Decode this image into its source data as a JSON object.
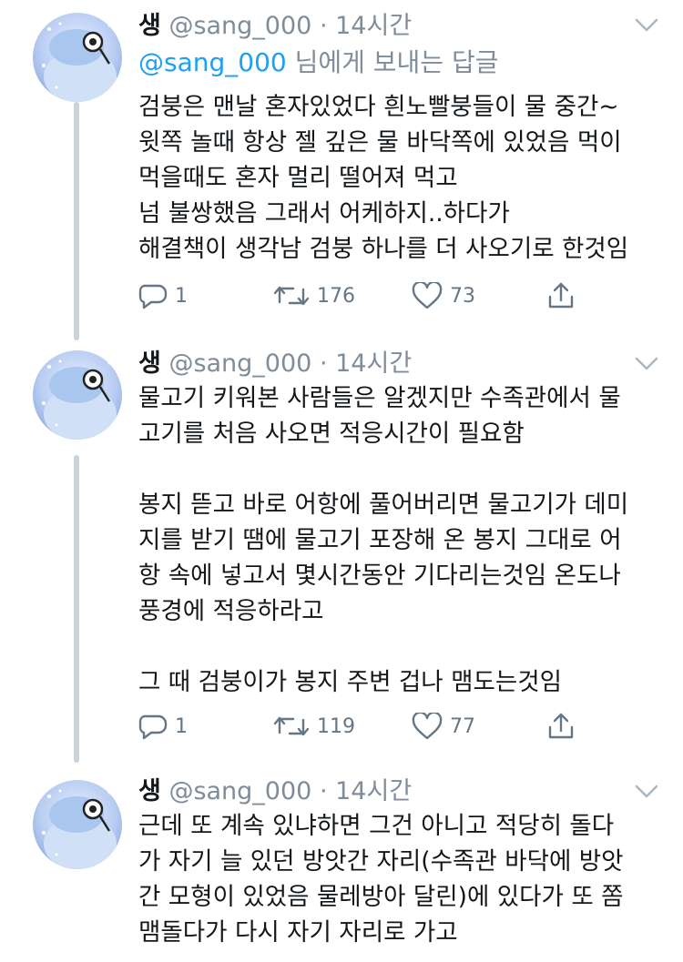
{
  "tweets": [
    {
      "display_name": "생",
      "handle": "@sang_000",
      "dot": "·",
      "time": "14시간",
      "replying_mention": "@sang_000",
      "replying_suffix": " 님에게 보내는 답글",
      "text": "검붕은 맨날 혼자있었다 흰노빨붕들이 물 중간~\n윗쪽 놀때 항상 젤 깊은 물 바닥쪽에 있었음 먹이\n먹을때도 혼자 멀리 떨어져 먹고\n넘 불쌍했음 그래서 어케하지..하다가\n해결책이 생각남 검붕 하나를 더 사오기로 한것임",
      "replies": "1",
      "retweets": "176",
      "likes": "73"
    },
    {
      "display_name": "생",
      "handle": "@sang_000",
      "dot": "·",
      "time": "14시간",
      "text": "물고기 키워본 사람들은 알겠지만 수족관에서 물\n고기를 처음 사오면 적응시간이 필요함\n\n봉지 뜯고 바로 어항에 풀어버리면 물고기가 데미\n지를 받기 땜에 물고기 포장해 온 봉지 그대로 어\n항 속에 넣고서 몇시간동안 기다리는것임 온도나\n풍경에 적응하라고\n\n그 때 검붕이가 봉지 주변 겁나 맴도는것임",
      "replies": "1",
      "retweets": "119",
      "likes": "77"
    },
    {
      "display_name": "생",
      "handle": "@sang_000",
      "dot": "·",
      "time": "14시간",
      "text": "근데 또 계속 있냐하면 그건 아니고 적당히 돌다\n가 자기 늘 있던 방앗간 자리(수족관 바닥에 방앗\n간 모형이 있었음 물레방아 달린)에 있다가 또 쫌\n맴돌다가 다시 자기 자리로 가고"
    }
  ],
  "colors": {
    "text": "#14171a",
    "secondary": "#7f8c99",
    "accent": "#1da1f2",
    "thread_line": "#c9d3dc"
  },
  "icons": {
    "reply": "speech-bubble-icon",
    "retweet": "retweet-icon",
    "like": "heart-icon",
    "share": "share-icon",
    "menu": "chevron-down-icon"
  }
}
